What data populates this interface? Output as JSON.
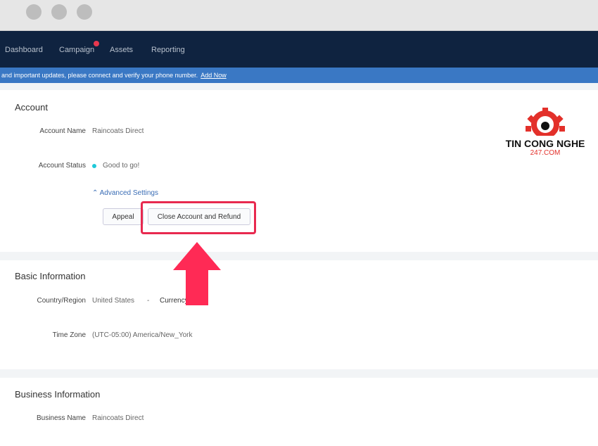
{
  "nav": {
    "items": [
      "Dashboard",
      "Campaign",
      "Assets",
      "Reporting"
    ]
  },
  "banner": {
    "text": "and important updates, please connect and verify your phone number.",
    "link": "Add Now"
  },
  "account": {
    "title": "Account",
    "name_label": "Account Name",
    "name_value": "Raincoats Direct",
    "status_label": "Account Status",
    "status_value": "Good to go!",
    "status_color": "#1ec8d8",
    "advanced": "Advanced Settings",
    "appeal": "Appeal",
    "close_refund": "Close Account and Refund"
  },
  "basic": {
    "title": "Basic Information",
    "country_label": "Country/Region",
    "country_value": "United States",
    "separator": "-",
    "currency_label": "Currency",
    "tz_label": "Time Zone",
    "tz_value": "(UTC-05:00) America/New_York"
  },
  "business": {
    "title": "Business Information",
    "name_label": "Business Name",
    "name_value": "Raincoats Direct"
  },
  "logo": {
    "line1": "TIN CONG NGHE",
    "line2": "247.COM"
  },
  "annotation_color": "#ff2a55"
}
